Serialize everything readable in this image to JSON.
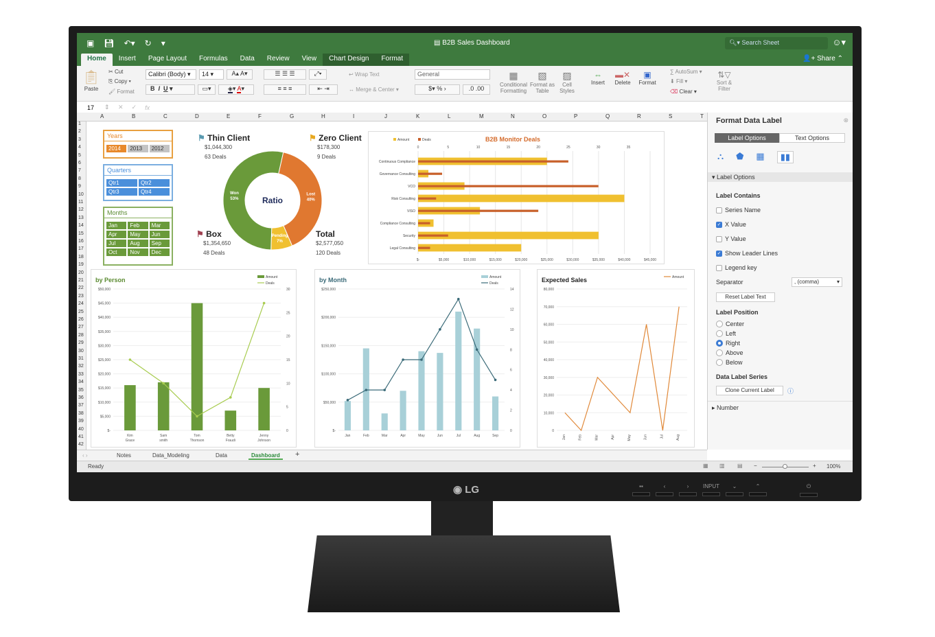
{
  "app": {
    "title": "B2B Sales Dashboard",
    "search_placeholder": "Search Sheet",
    "share_label": "Share",
    "tabs": [
      {
        "label": "Home",
        "active": true
      },
      {
        "label": "Insert"
      },
      {
        "label": "Page Layout"
      },
      {
        "label": "Formulas"
      },
      {
        "label": "Data"
      },
      {
        "label": "Review"
      },
      {
        "label": "View"
      },
      {
        "label": "Chart Design",
        "contextual": true
      },
      {
        "label": "Format",
        "contextual": true
      }
    ]
  },
  "ribbon": {
    "paste": "Paste",
    "cut": "Cut",
    "copy": "Copy",
    "format": "Format",
    "font": "Calibri (Body)",
    "font_size": "14",
    "wrap_text": "Wrap Text",
    "merge_center": "Merge & Center",
    "number_format": "General",
    "conditional_formatting": "Conditional Formatting",
    "format_as_table": "Format as Table",
    "cell_styles": "Cell Styles",
    "insert": "Insert",
    "delete": "Delete",
    "format_cells": "Format",
    "autosum": "AutoSum",
    "fill": "Fill",
    "clear": "Clear",
    "sort_filter": "Sort & Filter"
  },
  "formula_bar": {
    "cell_ref": "17",
    "formula": ""
  },
  "columns": [
    "A",
    "B",
    "C",
    "D",
    "E",
    "F",
    "G",
    "H",
    "I",
    "J",
    "K",
    "L",
    "M",
    "N",
    "O",
    "P",
    "Q",
    "R",
    "S",
    "T"
  ],
  "rows": [
    "1",
    "2",
    "3",
    "4",
    "5",
    "6",
    "7",
    "8",
    "9",
    "10",
    "11",
    "12",
    "13",
    "14",
    "15",
    "16",
    "17",
    "18",
    "19",
    "20",
    "21",
    "22",
    "23",
    "24",
    "25",
    "26",
    "27",
    "28",
    "29",
    "30",
    "31",
    "32",
    "33",
    "34",
    "35",
    "36",
    "37",
    "38",
    "39",
    "40",
    "41",
    "42"
  ],
  "slicers": {
    "years": {
      "title": "Years",
      "items": [
        "2014",
        "2013",
        "2012"
      ],
      "selected": "2014",
      "color": "#e8892b"
    },
    "quarters": {
      "title": "Quarters",
      "items": [
        "Qtr1",
        "Qtr2",
        "Qtr3",
        "Qtr4"
      ],
      "color": "#4a8fdb"
    },
    "months": {
      "title": "Months",
      "items": [
        "Jan",
        "Feb",
        "Mar",
        "Apr",
        "May",
        "Jun",
        "Jul",
        "Aug",
        "Sep",
        "Oct",
        "Nov",
        "Dec"
      ],
      "color": "#6a9a3a"
    }
  },
  "kpis": {
    "thin_client": {
      "title": "Thin Client",
      "amount": "$1,044,300",
      "deals": "63 Deals",
      "flag_color": "#5a9ab0"
    },
    "zero_client": {
      "title": "Zero Client",
      "amount": "$178,300",
      "deals": "9 Deals",
      "flag_color": "#e8a820"
    },
    "box": {
      "title": "Box",
      "amount": "$1,354,650",
      "deals": "48 Deals",
      "flag_color": "#a04050"
    },
    "total": {
      "title": "Total",
      "amount": "$2,577,050",
      "deals": "120 Deals"
    }
  },
  "chart_data": [
    {
      "type": "pie",
      "title": "Ratio",
      "categories": [
        "Won",
        "Lost",
        "Pending"
      ],
      "values": [
        53,
        40,
        7
      ],
      "labels": [
        "Won 53%",
        "Lost 40%",
        "Pending 7%"
      ],
      "colors": [
        "#6a9a3a",
        "#e07830",
        "#f0c030"
      ]
    },
    {
      "type": "bar",
      "title": "B2B Monitor Deals",
      "orientation": "horizontal",
      "categories": [
        "Continuous Compliance",
        "Governance Consulting",
        "VCO",
        "Risk Consulting",
        "VISO",
        "Compliance Consulting",
        "Security",
        "Legal Consulting"
      ],
      "series": [
        {
          "name": "Amount",
          "values": [
            25000,
            2000,
            9000,
            40000,
            12000,
            3000,
            35000,
            20000
          ],
          "color": "#f0c030"
        },
        {
          "name": "Deals",
          "values": [
            25,
            4,
            30,
            3,
            20,
            2,
            5,
            2
          ],
          "color": "#c8602a"
        }
      ],
      "x_ticks_bottom": [
        "$-",
        "$5,000",
        "$10,000",
        "$15,000",
        "$20,000",
        "$25,000",
        "$30,000",
        "$35,000",
        "$40,000",
        "$45,000"
      ],
      "x_ticks_top": [
        "0",
        "5",
        "10",
        "15",
        "20",
        "25",
        "30",
        "35"
      ],
      "xlim": [
        0,
        45000
      ],
      "xlim_top": [
        0,
        35
      ],
      "legend": "top-left"
    },
    {
      "type": "bar",
      "title": "by Person",
      "categories": [
        "Kim Grace",
        "Sam smith",
        "Tom Thomson",
        "Betty Fraudi",
        "Jenny Johnson"
      ],
      "series": [
        {
          "name": "Amount",
          "values": [
            16000,
            17000,
            45000,
            7000,
            15000
          ],
          "color": "#6a9a3a"
        },
        {
          "name": "Deals",
          "type": "line",
          "values": [
            15,
            10,
            3,
            7,
            27
          ],
          "color": "#a8cc50",
          "axis": "right"
        }
      ],
      "y_ticks": [
        "$-",
        "$5,000",
        "$10,000",
        "$15,000",
        "$20,000",
        "$25,000",
        "$30,000",
        "$35,000",
        "$40,000",
        "$45,000",
        "$50,000"
      ],
      "y2_ticks": [
        "0",
        "5",
        "10",
        "15",
        "20",
        "25",
        "30"
      ],
      "ylim": [
        0,
        50000
      ],
      "y2lim": [
        0,
        30
      ],
      "legend": "top-right"
    },
    {
      "type": "bar",
      "title": "by Month",
      "categories": [
        "Jan",
        "Feb",
        "Mar",
        "Apr",
        "May",
        "Jun",
        "Jul",
        "Aug",
        "Sep"
      ],
      "series": [
        {
          "name": "Amount",
          "values": [
            52000,
            145000,
            30000,
            70000,
            140000,
            137000,
            210000,
            180000,
            60000
          ],
          "color": "#a8d0d8"
        },
        {
          "name": "Deals",
          "type": "line",
          "values": [
            3,
            4,
            4,
            7,
            7,
            10,
            13,
            8,
            5
          ],
          "color": "#3a6a78",
          "axis": "right"
        }
      ],
      "y_ticks": [
        "$-",
        "$50,000",
        "$100,000",
        "$150,000",
        "$200,000",
        "$250,000"
      ],
      "y2_ticks": [
        "0",
        "2",
        "4",
        "6",
        "8",
        "10",
        "12",
        "14"
      ],
      "ylim": [
        0,
        250000
      ],
      "y2lim": [
        0,
        14
      ],
      "legend": "top-right"
    },
    {
      "type": "line",
      "title": "Expected Sales",
      "categories": [
        "Jan",
        "Feb",
        "Mar",
        "Apr",
        "May",
        "Jun",
        "Jul",
        "Aug"
      ],
      "series": [
        {
          "name": "Amount",
          "values": [
            10000,
            0,
            30000,
            20000,
            10000,
            60000,
            0,
            70000
          ],
          "color": "#e08838"
        }
      ],
      "y_ticks": [
        "0",
        "10,000",
        "20,000",
        "30,000",
        "40,000",
        "50,000",
        "60,000",
        "70,000",
        "80,000"
      ],
      "ylim": [
        0,
        80000
      ],
      "legend": "top-right"
    }
  ],
  "panel": {
    "title": "Format Data Label",
    "tab_label_options": "Label Options",
    "tab_text_options": "Text Options",
    "section": "Label Options",
    "label_contains": "Label Contains",
    "checkboxes": [
      {
        "label": "Series Name",
        "checked": false
      },
      {
        "label": "X Value",
        "checked": true
      },
      {
        "label": "Y Value",
        "checked": false
      },
      {
        "label": "Show Leader Lines",
        "checked": true
      },
      {
        "label": "Legend key",
        "checked": false
      }
    ],
    "separator_label": "Separator",
    "separator_value": ", (comma)",
    "reset_button": "Reset Label Text",
    "label_position": "Label Position",
    "positions": [
      {
        "label": "Center",
        "selected": false
      },
      {
        "label": "Left",
        "selected": false
      },
      {
        "label": "Right",
        "selected": true
      },
      {
        "label": "Above",
        "selected": false
      },
      {
        "label": "Below",
        "selected": false
      }
    ],
    "data_label_series": "Data Label Series",
    "clone_button": "Clone Current Label",
    "number_section": "Number"
  },
  "sheet_tabs": [
    {
      "label": "Notes"
    },
    {
      "label": "Data_Modeling"
    },
    {
      "label": "Data"
    },
    {
      "label": "Dashboard",
      "active": true
    }
  ],
  "status": {
    "text": "Ready",
    "zoom": "100%"
  },
  "monitor": {
    "brand": "LG",
    "input_label": "INPUT"
  }
}
